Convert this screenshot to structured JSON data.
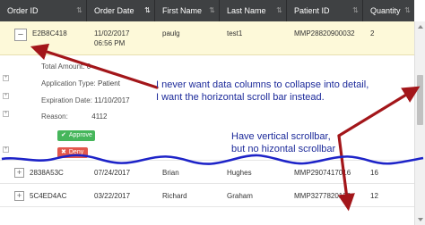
{
  "columns": [
    {
      "label": "Order ID"
    },
    {
      "label": "Order Date"
    },
    {
      "label": "First Name"
    },
    {
      "label": "Last Name"
    },
    {
      "label": "Patient ID"
    },
    {
      "label": "Quantity"
    }
  ],
  "rows": [
    {
      "toggle": "−",
      "id": "E2B8C418",
      "date": "11/02/2017",
      "time": "06:56 PM",
      "first": "paulg",
      "last": "test1",
      "pid": "MMP28820900032",
      "qty": "2"
    },
    {
      "toggle": "+",
      "id": "2838A53C",
      "date": "07/24/2017",
      "first": "Brian",
      "last": "Hughes",
      "pid": "MMP2907417016",
      "qty": "16"
    },
    {
      "toggle": "+",
      "id": "5C4ED4AC",
      "date": "03/22/2017",
      "first": "Richard",
      "last": "Graham",
      "pid": "MMP3277820133",
      "qty": "12"
    }
  ],
  "detail": {
    "total_amount_label": "Total Amount",
    "total_amount_value": "0",
    "application_type_label": "Application Type:",
    "application_type_value": "Patient",
    "expiration_date_label": "Expiration Date:",
    "expiration_date_value": "11/10/2017",
    "reason_label": "Reason:",
    "reason_value": "4112",
    "approve_label": "Approve",
    "deny_label": "Deny"
  },
  "annotations": {
    "note1_line1": "I never want data columns to collapse into detail,",
    "note1_line2": "I want the horizontal scroll bar instead.",
    "note2_line1": "Have vertical scrollbar,",
    "note2_line2": "but no hizontal scrollbar"
  },
  "colors": {
    "header_bg": "#3f4143",
    "selected_row_bg": "#fdf9d9",
    "approve": "#46b65b",
    "deny": "#e2574c",
    "annotation_arrow": "#a3161a",
    "annotation_text": "#1c2a9a"
  },
  "icons": {
    "sort": "sort-arrows-icon",
    "collapse": "minus-icon",
    "expand": "plus-icon",
    "approve": "check-icon",
    "deny": "x-icon"
  }
}
